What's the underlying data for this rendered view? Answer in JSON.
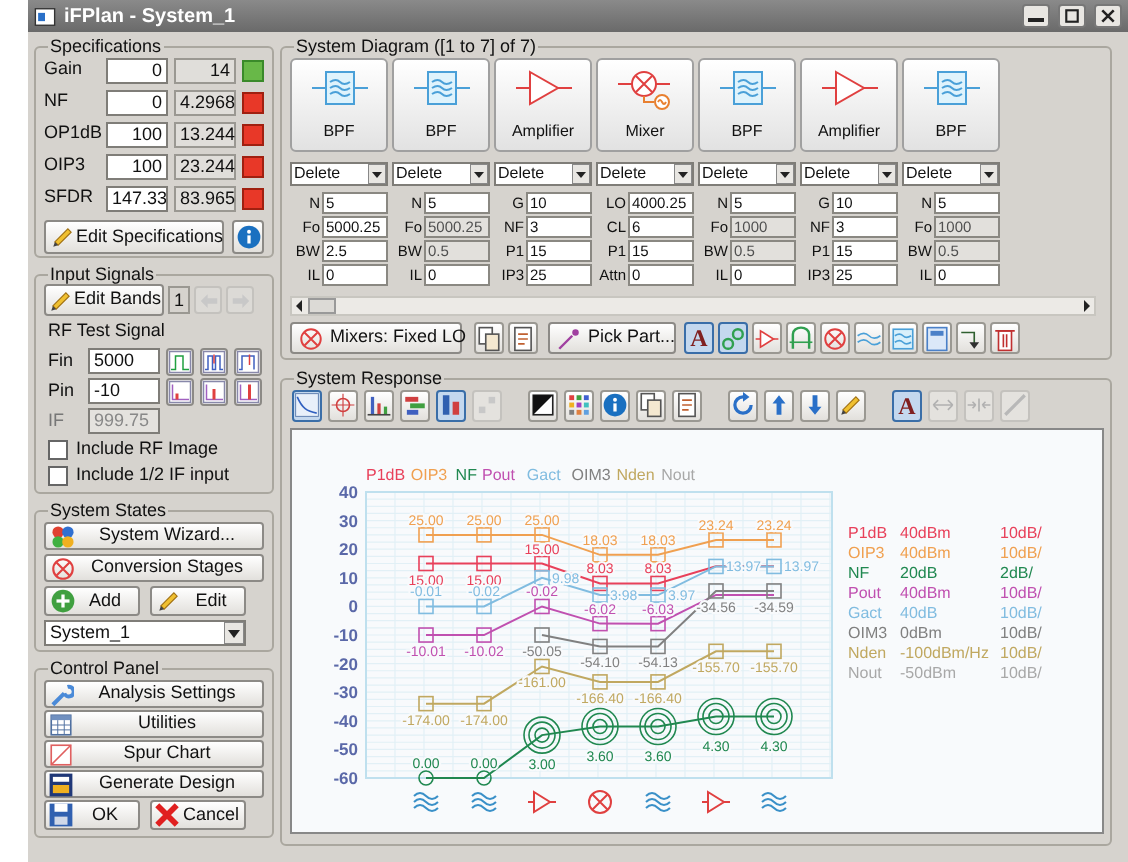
{
  "window": {
    "title": "iFPlan - System_1"
  },
  "specifications": {
    "title": "Specifications",
    "rows": [
      {
        "label": "Gain",
        "target": "0",
        "actual": "14",
        "met": true
      },
      {
        "label": "NF",
        "target": "0",
        "actual": "4.2968",
        "met": false
      },
      {
        "label": "OP1dB",
        "target": "100",
        "actual": "13.244",
        "met": false
      },
      {
        "label": "OIP3",
        "target": "100",
        "actual": "23.244",
        "met": false
      },
      {
        "label": "SFDR",
        "target": "147.33",
        "actual": "83.965",
        "met": false
      }
    ],
    "edit_button": "Edit Specifications"
  },
  "input_signals": {
    "title": "Input Signals",
    "edit_button": "Edit Bands",
    "band": "1",
    "band_nav": [
      {
        "disabled": true
      },
      {
        "disabled": true
      }
    ],
    "subtitle": "RF Test Signal",
    "fields": [
      {
        "label": "Fin",
        "value": "5000",
        "disabled": false
      },
      {
        "label": "Pin",
        "value": "-10",
        "disabled": false
      },
      {
        "label": "IF",
        "value": "999.75",
        "disabled": true
      }
    ],
    "checkboxes": [
      {
        "label": "Include RF Image",
        "checked": false
      },
      {
        "label": "Include 1/2 IF input",
        "checked": false
      }
    ]
  },
  "system_states": {
    "title": "System States",
    "buttons": [
      "System Wizard...",
      "Conversion Stages"
    ],
    "add_button": "Add",
    "edit_button": "Edit",
    "system_select": "System_1"
  },
  "control_panel": {
    "title": "Control Panel",
    "buttons": [
      "Analysis Settings",
      "Utilities",
      "Spur Chart",
      "Generate Design"
    ],
    "ok_button": "OK",
    "cancel_button": "Cancel"
  },
  "system_diagram": {
    "title": "System Diagram ([1 to 7] of 7)",
    "stages": [
      {
        "kind": "bpf",
        "label": "BPF",
        "action": "Delete",
        "params": [
          {
            "label": "N",
            "value": "5",
            "disabled": false
          },
          {
            "label": "Fo",
            "value": "5000.25",
            "disabled": false
          },
          {
            "label": "BW",
            "value": "2.5",
            "disabled": false
          },
          {
            "label": "IL",
            "value": "0",
            "disabled": false
          }
        ]
      },
      {
        "kind": "bpf",
        "label": "BPF",
        "action": "Delete",
        "params": [
          {
            "label": "N",
            "value": "5",
            "disabled": false
          },
          {
            "label": "Fo",
            "value": "5000.25",
            "disabled": true
          },
          {
            "label": "BW",
            "value": "0.5",
            "disabled": true
          },
          {
            "label": "IL",
            "value": "0",
            "disabled": false
          }
        ]
      },
      {
        "kind": "amplifier",
        "label": "Amplifier",
        "action": "Delete",
        "params": [
          {
            "label": "G",
            "value": "10",
            "disabled": false
          },
          {
            "label": "NF",
            "value": "3",
            "disabled": false
          },
          {
            "label": "P1",
            "value": "15",
            "disabled": false
          },
          {
            "label": "IP3",
            "value": "25",
            "disabled": false
          }
        ]
      },
      {
        "kind": "mixer",
        "label": "Mixer",
        "action": "Delete",
        "params": [
          {
            "label": "LO",
            "value": "4000.25",
            "disabled": false
          },
          {
            "label": "CL",
            "value": "6",
            "disabled": false
          },
          {
            "label": "P1",
            "value": "15",
            "disabled": false
          },
          {
            "label": "Attn",
            "value": "0",
            "disabled": false
          }
        ]
      },
      {
        "kind": "bpf",
        "label": "BPF",
        "action": "Delete",
        "params": [
          {
            "label": "N",
            "value": "5",
            "disabled": false
          },
          {
            "label": "Fo",
            "value": "1000",
            "disabled": true
          },
          {
            "label": "BW",
            "value": "0.5",
            "disabled": true
          },
          {
            "label": "IL",
            "value": "0",
            "disabled": false
          }
        ]
      },
      {
        "kind": "amplifier",
        "label": "Amplifier",
        "action": "Delete",
        "params": [
          {
            "label": "G",
            "value": "10",
            "disabled": false
          },
          {
            "label": "NF",
            "value": "3",
            "disabled": false
          },
          {
            "label": "P1",
            "value": "15",
            "disabled": false
          },
          {
            "label": "IP3",
            "value": "25",
            "disabled": false
          }
        ]
      },
      {
        "kind": "bpf",
        "label": "BPF",
        "action": "Delete",
        "params": [
          {
            "label": "N",
            "value": "5",
            "disabled": false
          },
          {
            "label": "Fo",
            "value": "1000",
            "disabled": true
          },
          {
            "label": "BW",
            "value": "0.5",
            "disabled": true
          },
          {
            "label": "IL",
            "value": "0",
            "disabled": false
          }
        ]
      }
    ],
    "toolbar": [
      {
        "kind": "button",
        "label": "Mixers: Fixed LO"
      },
      {
        "kind": "icon",
        "pressed": false
      },
      {
        "kind": "icon",
        "pressed": false
      },
      {
        "kind": "button",
        "label": "Pick Part..."
      },
      {
        "kind": "glyph",
        "glyph": "A",
        "pressed": true
      },
      {
        "kind": "icon",
        "pressed": true
      },
      {
        "kind": "icon",
        "pressed": false
      },
      {
        "kind": "icon",
        "pressed": false
      },
      {
        "kind": "icon",
        "pressed": false
      },
      {
        "kind": "icon",
        "pressed": false
      },
      {
        "kind": "icon",
        "pressed": false
      },
      {
        "kind": "icon",
        "pressed": false
      },
      {
        "kind": "icon",
        "pressed": false
      },
      {
        "kind": "icon",
        "pressed": false
      }
    ]
  },
  "system_response": {
    "title": "System Response",
    "toolbar": [
      {
        "kind": "icon",
        "pressed": true,
        "disabled": false
      },
      {
        "kind": "icon",
        "pressed": false,
        "disabled": false
      },
      {
        "kind": "icon",
        "pressed": false,
        "disabled": false
      },
      {
        "kind": "icon",
        "pressed": false,
        "disabled": false
      },
      {
        "kind": "icon",
        "pressed": true,
        "disabled": false
      },
      {
        "kind": "icon",
        "pressed": false,
        "disabled": true
      },
      {
        "kind": "icon",
        "pressed": false,
        "disabled": false
      },
      {
        "kind": "icon",
        "pressed": false,
        "disabled": false
      },
      {
        "kind": "icon",
        "pressed": false,
        "disabled": false
      },
      {
        "kind": "icon",
        "pressed": false,
        "disabled": false
      },
      {
        "kind": "icon",
        "pressed": false,
        "disabled": false
      },
      {
        "kind": "icon",
        "pressed": false,
        "disabled": false
      },
      {
        "kind": "icon",
        "pressed": false,
        "disabled": false
      },
      {
        "kind": "icon",
        "pressed": false,
        "disabled": false
      },
      {
        "kind": "icon",
        "pressed": false,
        "disabled": false
      },
      {
        "kind": "glyph",
        "glyph": "A",
        "pressed": true,
        "disabled": false
      },
      {
        "kind": "icon",
        "pressed": false,
        "disabled": true
      },
      {
        "kind": "icon",
        "pressed": false,
        "disabled": true
      },
      {
        "kind": "icon",
        "pressed": false,
        "disabled": true
      }
    ],
    "chart_data": {
      "type": "line",
      "grid": true,
      "ylim": [
        -60,
        40
      ],
      "yticks": [
        40,
        30,
        20,
        10,
        0,
        -10,
        -20,
        -30,
        -40,
        -50,
        -60
      ],
      "series": [
        {
          "name": "P1dB",
          "color": "#e8405a",
          "marker": "square",
          "values": [
            15,
            15,
            15,
            8.03,
            8.03,
            14,
            14
          ],
          "value_labels": [
            "15.00",
            "15.00",
            "15.00",
            "8.03",
            "8.03",
            null,
            null
          ]
        },
        {
          "name": "OIP3",
          "color": "#f0a050",
          "marker": "square",
          "values": [
            25,
            25,
            25,
            18.03,
            18.03,
            23.24,
            23.24
          ],
          "value_labels": [
            "25.00",
            "25.00",
            "25.00",
            "18.03",
            "18.03",
            "23.24",
            "23.24"
          ]
        },
        {
          "name": "NF",
          "color": "#208850",
          "marker": "circle",
          "values": [
            -60,
            -60,
            -45,
            -42,
            -42,
            -38.5,
            -38.5
          ]
        },
        {
          "name": "Pout",
          "color": "#c050b0",
          "marker": "square",
          "values": [
            -10.01,
            -10.02,
            -0.02,
            -6.02,
            -6.03,
            4,
            4
          ],
          "value_labels": [
            "-10.01",
            "-10.02",
            "-0.02",
            "-6.02",
            "-6.03",
            null,
            null
          ]
        },
        {
          "name": "Gact",
          "color": "#80bce0",
          "marker": "square",
          "values": [
            -0.01,
            -0.02,
            9.98,
            3.98,
            3.97,
            13.97,
            13.97
          ],
          "value_labels": [
            "-0.01",
            "-0.02",
            "9.98",
            "3.98",
            "3.97",
            "13.97",
            "13.97"
          ]
        },
        {
          "name": "OIM3",
          "color": "#808080",
          "marker": "square",
          "values": [
            null,
            null,
            -10,
            -14,
            -14,
            5.4,
            5.4
          ]
        },
        {
          "name": "Nden",
          "color": "#c0a860",
          "marker": "square",
          "values": [
            -34,
            -34,
            -21,
            -26.4,
            -26.4,
            -15.7,
            -15.7
          ]
        },
        {
          "name": "Nout",
          "color": "#a8a8a8",
          "values": [
            null,
            null,
            null,
            null,
            null,
            null,
            null
          ]
        }
      ],
      "annotations": [
        {
          "y": -60,
          "text": "0.00"
        },
        {
          "y": -60,
          "text": "0.00"
        },
        {
          "y": -45,
          "text": "3.00"
        },
        {
          "y": -42,
          "text": "3.60"
        },
        {
          "y": -42,
          "text": "3.60"
        },
        {
          "y": -38.5,
          "text": "4.30"
        },
        {
          "y": -38.5,
          "text": "4.30"
        },
        {
          "y": -10,
          "text": "-50.05"
        },
        {
          "y": -14,
          "text": "-54.10"
        },
        {
          "y": -14,
          "text": "-54.13"
        },
        {
          "y": 5.4,
          "text": "-34.56"
        },
        {
          "y": 5.4,
          "text": "-34.59"
        },
        {
          "y": -34,
          "text": "-174.00"
        },
        {
          "y": -34,
          "text": "-174.00"
        },
        {
          "y": -21,
          "text": "-161.00"
        },
        {
          "y": -26.4,
          "text": "-166.40"
        },
        {
          "y": -26.4,
          "text": "-166.40"
        },
        {
          "y": -15.7,
          "text": "-155.70"
        },
        {
          "y": -15.7,
          "text": "-155.70"
        }
      ]
    },
    "legend": [
      {
        "name": "P1dB",
        "scale": "40dBm",
        "per_div": "10dB/",
        "color": "#e8405a"
      },
      {
        "name": "OIP3",
        "scale": "40dBm",
        "per_div": "10dB/",
        "color": "#f0a050"
      },
      {
        "name": "NF",
        "scale": "20dB",
        "per_div": "2dB/",
        "color": "#208850"
      },
      {
        "name": "Pout",
        "scale": "40dBm",
        "per_div": "10dB/",
        "color": "#c050b0"
      },
      {
        "name": "Gact",
        "scale": "40dB",
        "per_div": "10dB/",
        "color": "#80bce0"
      },
      {
        "name": "OIM3",
        "scale": "0dBm",
        "per_div": "10dB/",
        "color": "#808080"
      },
      {
        "name": "Nden",
        "scale": "-100dBm/Hz",
        "per_div": "10dB/",
        "color": "#c0a860"
      },
      {
        "name": "Nout",
        "scale": "-50dBm",
        "per_div": "10dB/",
        "color": "#a8a8a8"
      }
    ]
  }
}
